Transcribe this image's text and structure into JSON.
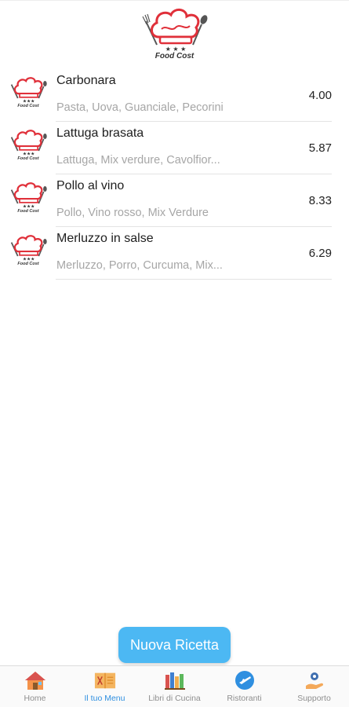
{
  "header": {
    "logo_text": "Food Cost"
  },
  "recipes": [
    {
      "name": "Carbonara",
      "ingredients": "Pasta, Uova, Guanciale, Pecorini",
      "price": "4.00",
      "thumb_text": "Food Cost"
    },
    {
      "name": "Lattuga brasata",
      "ingredients": "Lattuga, Mix verdure, Cavolfior...",
      "price": "5.87",
      "thumb_text": "Food Cost"
    },
    {
      "name": "Pollo al vino",
      "ingredients": "Pollo, Vino rosso, Mix Verdure",
      "price": "8.33",
      "thumb_text": "Food Cost"
    },
    {
      "name": "Merluzzo in salse",
      "ingredients": "Merluzzo, Porro, Curcuma, Mix...",
      "price": "6.29",
      "thumb_text": "Food Cost"
    }
  ],
  "fab": {
    "label": "Nuova Ricetta"
  },
  "tabs": [
    {
      "label": "Home",
      "icon": "house-icon",
      "active": false
    },
    {
      "label": "Il tuo Menu",
      "icon": "menu-icon",
      "active": true
    },
    {
      "label": "Libri di Cucina",
      "icon": "books-icon",
      "active": false
    },
    {
      "label": "Ristoranti",
      "icon": "plane-icon",
      "active": false
    },
    {
      "label": "Supporto",
      "icon": "support-icon",
      "active": false
    }
  ],
  "colors": {
    "accent": "#4cb8f3",
    "active_tab": "#2f8fe0",
    "logo_red": "#e0303a"
  }
}
